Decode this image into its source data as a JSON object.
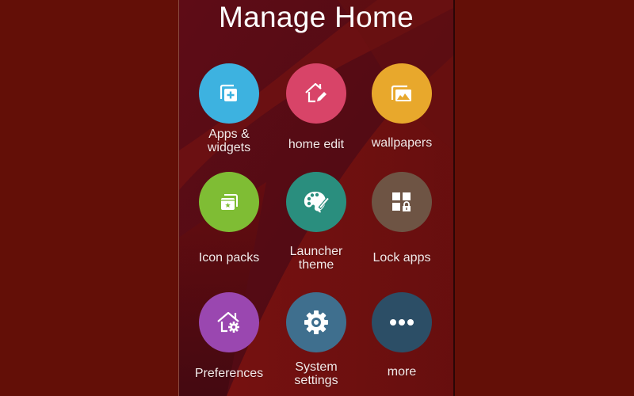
{
  "header": {
    "title": "Manage Home"
  },
  "colors": {
    "outer_background": "#630f07",
    "screen_background": "#5a0e14"
  },
  "items": [
    {
      "id": "apps-widgets",
      "label": "Apps &\nwidgets",
      "icon": "add-widget-icon",
      "color": "#3db2e0"
    },
    {
      "id": "home-edit",
      "label": "home edit",
      "icon": "home-edit-icon",
      "color": "#d84468"
    },
    {
      "id": "wallpapers",
      "label": "wallpapers",
      "icon": "wallpaper-icon",
      "color": "#e8a82c"
    },
    {
      "id": "icon-packs",
      "label": "Icon packs",
      "icon": "icon-pack-icon",
      "color": "#7fbd34"
    },
    {
      "id": "launcher-theme",
      "label": "Launcher\ntheme",
      "icon": "palette-icon",
      "color": "#2a8e7e"
    },
    {
      "id": "lock-apps",
      "label": "Lock apps",
      "icon": "lock-apps-icon",
      "color": "#6e5444"
    },
    {
      "id": "preferences",
      "label": "Preferences",
      "icon": "home-settings-icon",
      "color": "#9a47b0"
    },
    {
      "id": "system-settings",
      "label": "System\nsettings",
      "icon": "gear-icon",
      "color": "#3f6f8e"
    },
    {
      "id": "more",
      "label": "more",
      "icon": "more-dots-icon",
      "color": "#2c4e66"
    }
  ]
}
